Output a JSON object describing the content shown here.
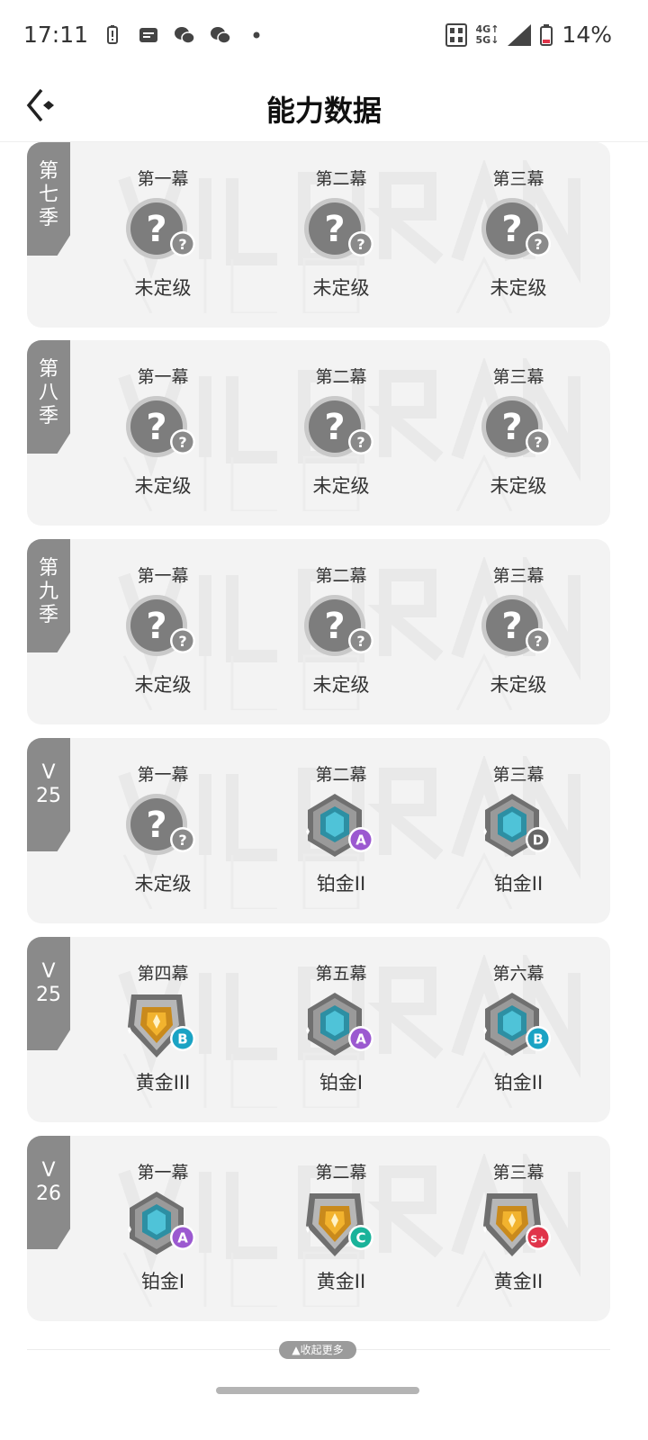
{
  "status_bar": {
    "time": "17:11",
    "network": "4G 5G",
    "battery": "14%"
  },
  "header": {
    "title": "能力数据"
  },
  "collapse_label": "▲收起更多",
  "seasons": [
    {
      "tag": "第\n七\n季",
      "acts": [
        {
          "name": "第一幕",
          "rank": "未定级",
          "type": "unranked",
          "letter": "?",
          "letter_color": "#8a8a8a"
        },
        {
          "name": "第二幕",
          "rank": "未定级",
          "type": "unranked",
          "letter": "?",
          "letter_color": "#8a8a8a"
        },
        {
          "name": "第三幕",
          "rank": "未定级",
          "type": "unranked",
          "letter": "?",
          "letter_color": "#8a8a8a"
        }
      ]
    },
    {
      "tag": "第\n八\n季",
      "acts": [
        {
          "name": "第一幕",
          "rank": "未定级",
          "type": "unranked",
          "letter": "?",
          "letter_color": "#8a8a8a"
        },
        {
          "name": "第二幕",
          "rank": "未定级",
          "type": "unranked",
          "letter": "?",
          "letter_color": "#8a8a8a"
        },
        {
          "name": "第三幕",
          "rank": "未定级",
          "type": "unranked",
          "letter": "?",
          "letter_color": "#8a8a8a"
        }
      ]
    },
    {
      "tag": "第\n九\n季",
      "acts": [
        {
          "name": "第一幕",
          "rank": "未定级",
          "type": "unranked",
          "letter": "?",
          "letter_color": "#8a8a8a"
        },
        {
          "name": "第二幕",
          "rank": "未定级",
          "type": "unranked",
          "letter": "?",
          "letter_color": "#8a8a8a"
        },
        {
          "name": "第三幕",
          "rank": "未定级",
          "type": "unranked",
          "letter": "?",
          "letter_color": "#8a8a8a"
        }
      ]
    },
    {
      "tag": "V\n25",
      "acts": [
        {
          "name": "第一幕",
          "rank": "未定级",
          "type": "unranked",
          "letter": "?",
          "letter_color": "#8a8a8a"
        },
        {
          "name": "第二幕",
          "rank": "铂金II",
          "type": "platinum",
          "letter": "A",
          "letter_color": "#9b59d0"
        },
        {
          "name": "第三幕",
          "rank": "铂金II",
          "type": "platinum",
          "letter": "D",
          "letter_color": "#666666"
        }
      ]
    },
    {
      "tag": "V\n25",
      "acts": [
        {
          "name": "第四幕",
          "rank": "黄金III",
          "type": "gold",
          "letter": "B",
          "letter_color": "#1aa3c4"
        },
        {
          "name": "第五幕",
          "rank": "铂金I",
          "type": "platinum",
          "letter": "A",
          "letter_color": "#9b59d0"
        },
        {
          "name": "第六幕",
          "rank": "铂金II",
          "type": "platinum",
          "letter": "B",
          "letter_color": "#1aa3c4"
        }
      ]
    },
    {
      "tag": "V\n26",
      "acts": [
        {
          "name": "第一幕",
          "rank": "铂金I",
          "type": "platinum",
          "letter": "A",
          "letter_color": "#9b59d0"
        },
        {
          "name": "第二幕",
          "rank": "黄金II",
          "type": "gold",
          "letter": "C",
          "letter_color": "#1ab39a"
        },
        {
          "name": "第三幕",
          "rank": "黄金II",
          "type": "gold",
          "letter": "S+",
          "letter_color": "#e0344a"
        }
      ]
    }
  ]
}
